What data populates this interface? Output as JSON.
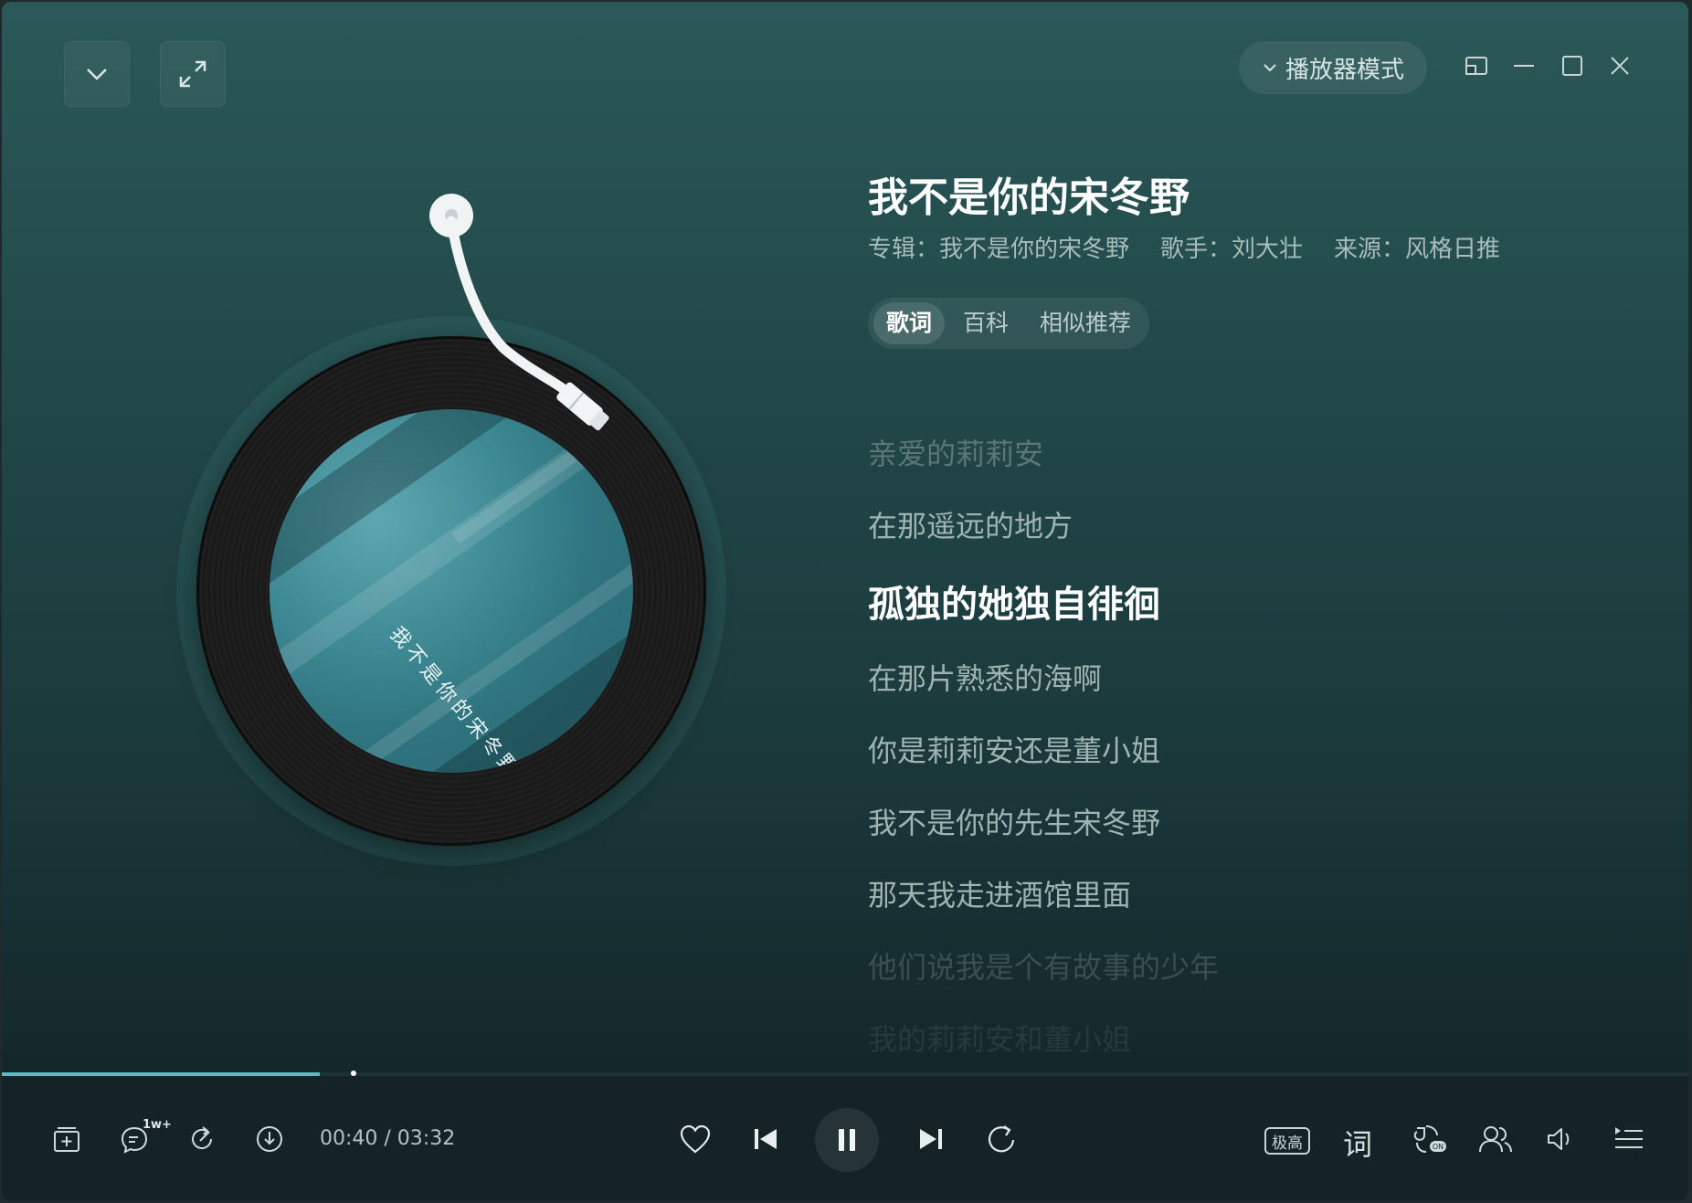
{
  "window": {
    "mode_label": "播放器模式"
  },
  "song": {
    "title": "我不是你的宋冬野",
    "album": "专辑：我不是你的宋冬野",
    "artist": "歌手：刘大壮",
    "source": "来源：风格日推"
  },
  "tabs": [
    {
      "label": "歌词",
      "active": true
    },
    {
      "label": "百科",
      "active": false
    },
    {
      "label": "相似推荐",
      "active": false
    }
  ],
  "lyrics": [
    {
      "text": "亲爱的莉莉安",
      "state": "fade1"
    },
    {
      "text": "在那遥远的地方",
      "state": "normal"
    },
    {
      "text": "孤独的她独自徘徊",
      "state": "current"
    },
    {
      "text": "在那片熟悉的海啊",
      "state": "normal"
    },
    {
      "text": "你是莉莉安还是董小姐",
      "state": "normal"
    },
    {
      "text": "我不是你的先生宋冬野",
      "state": "normal"
    },
    {
      "text": "那天我走进酒馆里面",
      "state": "normal"
    },
    {
      "text": "他们说我是个有故事的少年",
      "state": "fade2"
    },
    {
      "text": "我的莉莉安和董小姐",
      "state": "fade3"
    }
  ],
  "player": {
    "elapsed": "00:40",
    "total": "03:32",
    "time_display": "00:40 / 03:32",
    "progress_fraction": 0.1887,
    "comment_badge": "1w+",
    "quality_label": "极高",
    "lyric_button_label": "词"
  },
  "cover": {
    "text": "我不是你的宋冬野"
  },
  "colors": {
    "accent": "#59bcc4",
    "bg_top": "#2b5858",
    "bg_bottom": "#122326"
  },
  "icons": {
    "collapse": "chevron-down-icon",
    "fullscreen": "expand-icon",
    "mini": "mini-window-icon",
    "minimize": "minimize-icon",
    "maximize": "maximize-icon",
    "close": "close-icon",
    "add_to_playlist": "add-to-playlist-icon",
    "comment": "comment-icon",
    "share": "share-icon",
    "download": "download-icon",
    "like": "heart-icon",
    "prev": "previous-icon",
    "pause": "pause-icon",
    "next": "next-icon",
    "repeat": "repeat-icon",
    "effect": "sound-effect-icon",
    "listen_together": "listen-together-icon",
    "volume": "volume-icon",
    "playlist": "playlist-icon"
  }
}
